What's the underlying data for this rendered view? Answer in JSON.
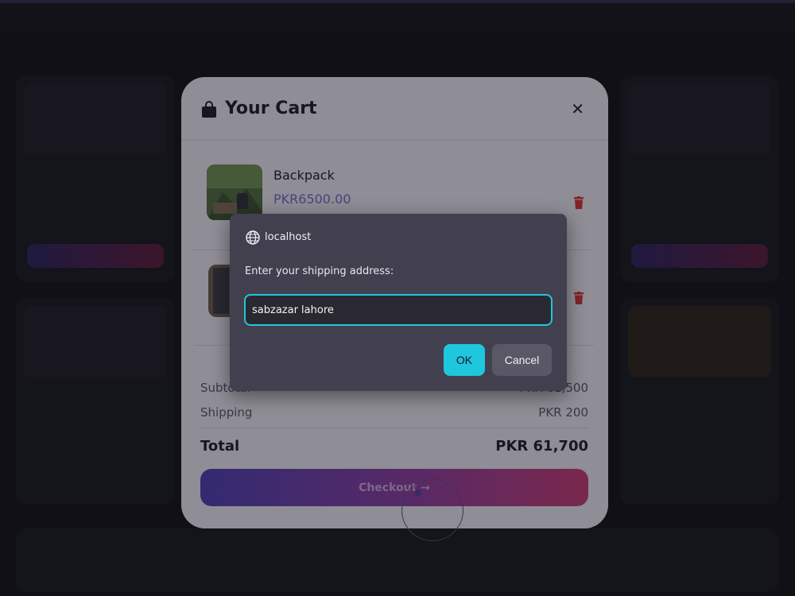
{
  "cart": {
    "title": "Your Cart",
    "items": [
      {
        "name": "Backpack",
        "price": "PKR6500.00"
      },
      {
        "name": "",
        "price": ""
      }
    ],
    "summary": {
      "subtotal_label": "Subtotal",
      "subtotal_value": "PKR 61,500",
      "shipping_label": "Shipping",
      "shipping_value": "PKR 200",
      "total_label": "Total",
      "total_value": "PKR 61,700"
    },
    "checkout_label": "Checkout →"
  },
  "prompt": {
    "origin": "localhost",
    "message": "Enter your shipping address:",
    "input_value": "sabzazar lahore",
    "ok_label": "OK",
    "cancel_label": "Cancel"
  },
  "colors": {
    "accent": "#1ec6de",
    "price": "#6e64c8",
    "delete": "#d32f2f"
  }
}
